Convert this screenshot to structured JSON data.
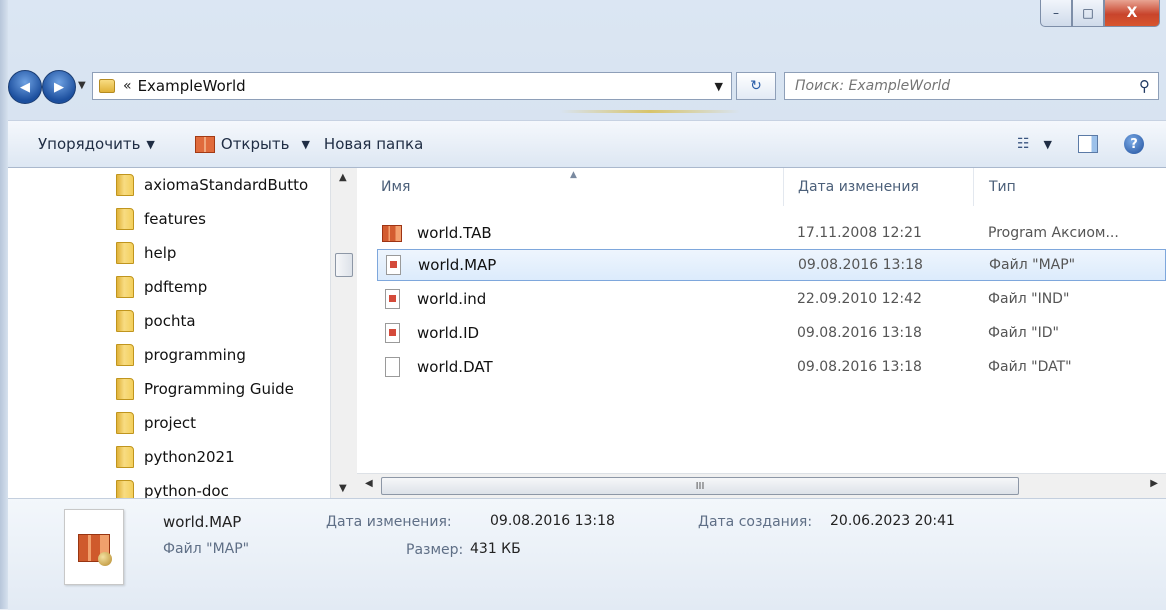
{
  "window": {
    "caption_buttons": {
      "minimize": "–",
      "maximize": "□",
      "close": "X"
    }
  },
  "navigation": {
    "back_glyph": "◀",
    "forward_glyph": "▶",
    "history_dropdown": "▼",
    "address_chevron": "«",
    "address_text": "ExampleWorld",
    "address_dropdown": "▼",
    "refresh_glyph": "↻",
    "search_placeholder": "Поиск: ExampleWorld",
    "search_icon": "⚲"
  },
  "command_bar": {
    "organize": "Упорядочить",
    "open": "Открыть",
    "new_folder": "Новая папка",
    "dropdown_arrow": "▼",
    "view_icon": "☷",
    "help_glyph": "?"
  },
  "nav_pane": {
    "items": [
      "axiomaStandardButto",
      "features",
      "help",
      "pdftemp",
      "pochta",
      "programming",
      "Programming Guide",
      "project",
      "python2021",
      "python-doc"
    ],
    "scroll_up": "▲",
    "scroll_down": "▼"
  },
  "file_list": {
    "columns": {
      "name": "Имя",
      "date": "Дата изменения",
      "type": "Тип"
    },
    "sort_arrow": "▲",
    "rows": [
      {
        "name": "world.TAB",
        "date": "17.11.2008 12:21",
        "type": "Program Аксиом...",
        "icon": "map-tab-icon",
        "selected": false
      },
      {
        "name": "world.MAP",
        "date": "09.08.2016 13:18",
        "type": "Файл \"MAP\"",
        "icon": "map-file-icon",
        "selected": true
      },
      {
        "name": "world.ind",
        "date": "22.09.2010 12:42",
        "type": "Файл \"IND\"",
        "icon": "map-file-icon",
        "selected": false
      },
      {
        "name": "world.ID",
        "date": "09.08.2016 13:18",
        "type": "Файл \"ID\"",
        "icon": "map-file-icon",
        "selected": false
      },
      {
        "name": "world.DAT",
        "date": "09.08.2016 13:18",
        "type": "Файл \"DAT\"",
        "icon": "blank-file-icon",
        "selected": false
      }
    ],
    "hscroll": {
      "left": "◀",
      "right": "▶",
      "grip": "III"
    }
  },
  "details": {
    "file_name": "world.MAP",
    "file_type": "Файл \"MAP\"",
    "modified_label": "Дата изменения:",
    "modified_value": "09.08.2016 13:18",
    "size_label": "Размер:",
    "size_value": "431 КБ",
    "created_label": "Дата создания:",
    "created_value": "20.06.2023 20:41"
  }
}
